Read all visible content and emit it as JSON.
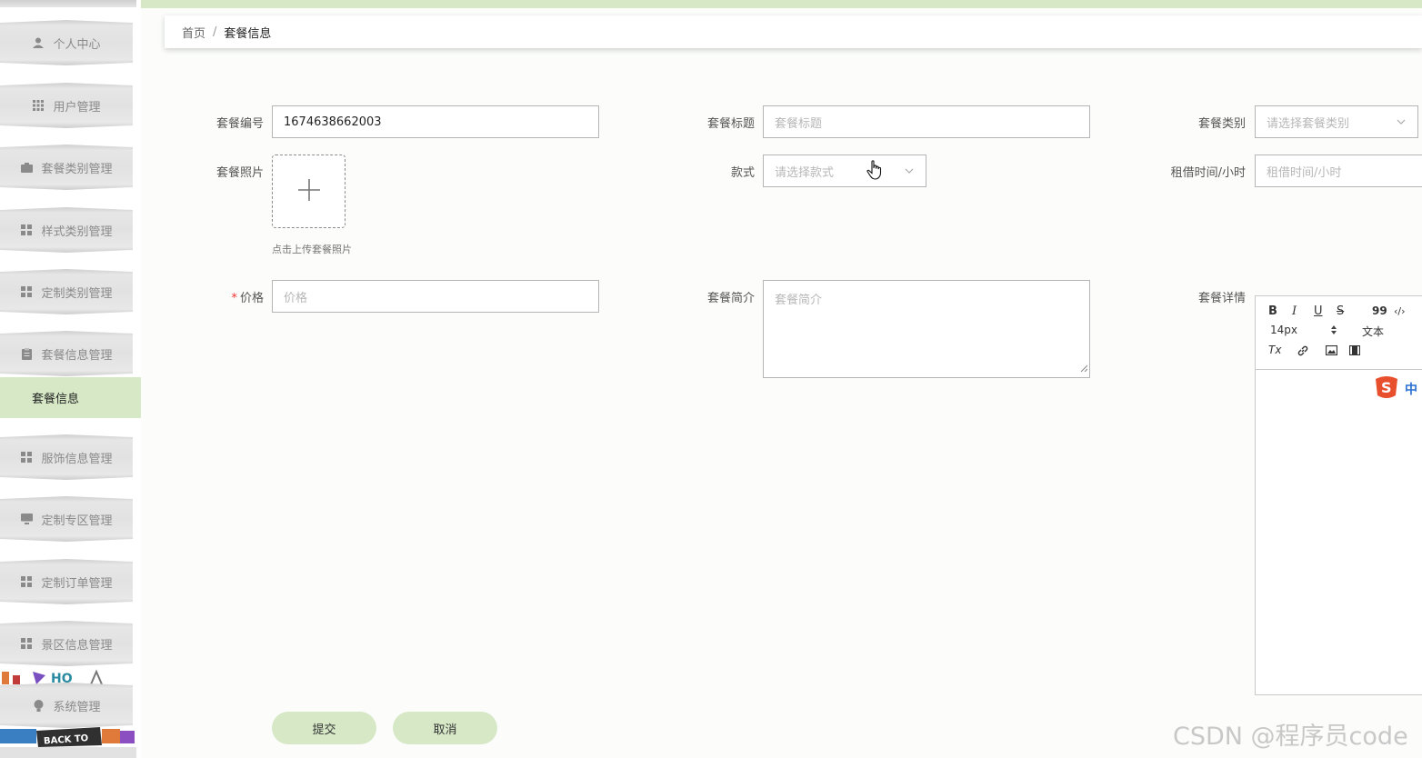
{
  "sidebar": {
    "items": [
      {
        "label": "个人中心",
        "icon": "user-icon"
      },
      {
        "label": "用户管理",
        "icon": "grid-icon"
      },
      {
        "label": "套餐类别管理",
        "icon": "briefcase-icon"
      },
      {
        "label": "样式类别管理",
        "icon": "apps-icon"
      },
      {
        "label": "定制类别管理",
        "icon": "apps-icon"
      },
      {
        "label": "套餐信息管理",
        "icon": "clipboard-icon"
      },
      {
        "label": "服饰信息管理",
        "icon": "apps-icon"
      },
      {
        "label": "定制专区管理",
        "icon": "monitor-icon"
      },
      {
        "label": "定制订单管理",
        "icon": "apps-icon"
      },
      {
        "label": "景区信息管理",
        "icon": "apps-icon"
      },
      {
        "label": "系统管理",
        "icon": "bulb-icon"
      }
    ],
    "submenu_active": "套餐信息",
    "deco_text": "HO",
    "back_to": "BACK TO"
  },
  "breadcrumb": {
    "home": "首页",
    "separator": "/",
    "current": "套餐信息"
  },
  "form": {
    "package_no": {
      "label": "套餐编号",
      "value": "1674638662003"
    },
    "package_title": {
      "label": "套餐标题",
      "placeholder": "套餐标题"
    },
    "package_category": {
      "label": "套餐类别",
      "placeholder": "请选择套餐类别"
    },
    "package_photo": {
      "label": "套餐照片",
      "hint": "点击上传套餐照片"
    },
    "style": {
      "label": "款式",
      "placeholder": "请选择款式"
    },
    "rental_hours": {
      "label": "租借时间/小时",
      "placeholder": "租借时间/小时"
    },
    "price": {
      "label": "价格",
      "required_mark": "*",
      "placeholder": "价格"
    },
    "summary": {
      "label": "套餐简介",
      "placeholder": "套餐简介"
    },
    "details": {
      "label": "套餐详情",
      "toolbar": {
        "bold": "B",
        "italic": "I",
        "underline": "U",
        "strike": "S",
        "quote": "99",
        "code": "‹/›",
        "font_size": "14px",
        "header": "文本",
        "clean": "Tx"
      }
    }
  },
  "buttons": {
    "submit": "提交",
    "cancel": "取消"
  },
  "watermark": "CSDN @程序员code",
  "ime": {
    "badge": "中"
  },
  "colors": {
    "accent": "#d6e8c6",
    "required": "#e33333",
    "placeholder": "#b7b7b7"
  }
}
